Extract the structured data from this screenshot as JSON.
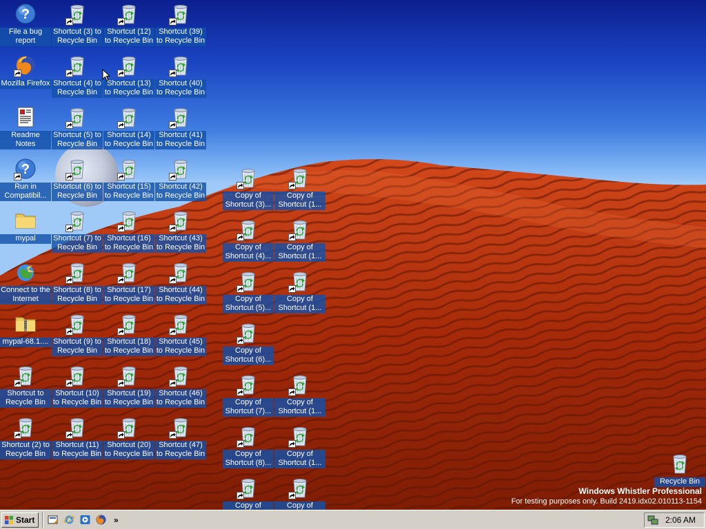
{
  "desktop": {
    "icons": [
      {
        "label": "File a bug report",
        "icon": "help-icon",
        "shortcut": false
      },
      {
        "label": "Mozilla Firefox",
        "icon": "firefox-icon",
        "shortcut": true
      },
      {
        "label": "Readme Notes",
        "icon": "document-icon",
        "shortcut": false
      },
      {
        "label": "Run in Compatibil...",
        "icon": "help-icon",
        "shortcut": true
      },
      {
        "label": "mypal",
        "icon": "folder-icon",
        "shortcut": false
      },
      {
        "label": "Connect to the Internet",
        "icon": "connect-icon",
        "shortcut": false
      },
      {
        "label": "mypal-68.1....",
        "icon": "zip-folder-icon",
        "shortcut": false
      },
      {
        "label": "Shortcut to Recycle Bin",
        "icon": "recycle-bin-icon",
        "shortcut": true
      },
      {
        "label": "Shortcut (2) to Recycle Bin",
        "icon": "recycle-bin-icon",
        "shortcut": true
      },
      {
        "label": "Shortcut (3) to Recycle Bin",
        "icon": "recycle-bin-icon",
        "shortcut": true
      },
      {
        "label": "Shortcut (4) to Recycle Bin",
        "icon": "recycle-bin-icon",
        "shortcut": true
      },
      {
        "label": "Shortcut (5) to Recycle Bin",
        "icon": "recycle-bin-icon",
        "shortcut": true
      },
      {
        "label": "Shortcut (6) to Recycle Bin",
        "icon": "recycle-bin-icon",
        "shortcut": true
      },
      {
        "label": "Shortcut (7) to Recycle Bin",
        "icon": "recycle-bin-icon",
        "shortcut": true
      },
      {
        "label": "Shortcut (8) to Recycle Bin",
        "icon": "recycle-bin-icon",
        "shortcut": true
      },
      {
        "label": "Shortcut (9) to Recycle Bin",
        "icon": "recycle-bin-icon",
        "shortcut": true
      },
      {
        "label": "Shortcut (10) to Recycle Bin",
        "icon": "recycle-bin-icon",
        "shortcut": true
      },
      {
        "label": "Shortcut (11) to Recycle Bin",
        "icon": "recycle-bin-icon",
        "shortcut": true
      },
      {
        "label": "Shortcut (12) to Recycle Bin",
        "icon": "recycle-bin-icon",
        "shortcut": true
      },
      {
        "label": "Shortcut (13) to Recycle Bin",
        "icon": "recycle-bin-icon",
        "shortcut": true
      },
      {
        "label": "Shortcut (14) to Recycle Bin",
        "icon": "recycle-bin-icon",
        "shortcut": true
      },
      {
        "label": "Shortcut (15) to Recycle Bin",
        "icon": "recycle-bin-icon",
        "shortcut": true
      },
      {
        "label": "Shortcut (16) to Recycle Bin",
        "icon": "recycle-bin-icon",
        "shortcut": true
      },
      {
        "label": "Shortcut (17) to Recycle Bin",
        "icon": "recycle-bin-icon",
        "shortcut": true
      },
      {
        "label": "Shortcut (18) to Recycle Bin",
        "icon": "recycle-bin-icon",
        "shortcut": true
      },
      {
        "label": "Shortcut (19) to Recycle Bin",
        "icon": "recycle-bin-icon",
        "shortcut": true
      },
      {
        "label": "Shortcut (20) to Recycle Bin",
        "icon": "recycle-bin-icon",
        "shortcut": true
      },
      {
        "label": "Shortcut (39) to Recycle Bin",
        "icon": "recycle-bin-icon",
        "shortcut": true
      },
      {
        "label": "Shortcut (40) to Recycle Bin",
        "icon": "recycle-bin-icon",
        "shortcut": true
      },
      {
        "label": "Shortcut (41) to Recycle Bin",
        "icon": "recycle-bin-icon",
        "shortcut": true
      },
      {
        "label": "Shortcut (42) to Recycle Bin",
        "icon": "recycle-bin-icon",
        "shortcut": true
      },
      {
        "label": "Shortcut (43) to Recycle Bin",
        "icon": "recycle-bin-icon",
        "shortcut": true
      },
      {
        "label": "Shortcut (44) to Recycle Bin",
        "icon": "recycle-bin-icon",
        "shortcut": true
      },
      {
        "label": "Shortcut (45) to Recycle Bin",
        "icon": "recycle-bin-icon",
        "shortcut": true
      },
      {
        "label": "Shortcut (46) to Recycle Bin",
        "icon": "recycle-bin-icon",
        "shortcut": true
      },
      {
        "label": "Shortcut (47) to Recycle Bin",
        "icon": "recycle-bin-icon",
        "shortcut": true
      },
      {
        "label": "Copy of Shortcut (3)...",
        "icon": "recycle-bin-icon",
        "shortcut": true
      },
      {
        "label": "Copy of Shortcut (4)...",
        "icon": "recycle-bin-icon",
        "shortcut": true
      },
      {
        "label": "Copy of Shortcut (5)...",
        "icon": "recycle-bin-icon",
        "shortcut": true
      },
      {
        "label": "Copy of Shortcut (6)...",
        "icon": "recycle-bin-icon",
        "shortcut": true
      },
      {
        "label": "Copy of Shortcut (7)...",
        "icon": "recycle-bin-icon",
        "shortcut": true
      },
      {
        "label": "Copy of Shortcut (8)...",
        "icon": "recycle-bin-icon",
        "shortcut": true
      },
      {
        "label": "Copy of",
        "icon": "recycle-bin-icon",
        "shortcut": true
      },
      {
        "label": "Copy of Shortcut (1...",
        "icon": "recycle-bin-icon",
        "shortcut": true
      },
      {
        "label": "Copy of Shortcut (1...",
        "icon": "recycle-bin-icon",
        "shortcut": true
      },
      {
        "label": "Copy of Shortcut (1...",
        "icon": "recycle-bin-icon",
        "shortcut": true
      },
      {
        "label": "Copy of Shortcut (1...",
        "icon": "recycle-bin-icon",
        "shortcut": true
      },
      {
        "label": "Copy of Shortcut (1...",
        "icon": "recycle-bin-icon",
        "shortcut": true
      },
      {
        "label": "Copy of",
        "icon": "recycle-bin-icon",
        "shortcut": true
      },
      {
        "label": "Recycle Bin",
        "icon": "recycle-bin-icon",
        "shortcut": false
      }
    ]
  },
  "watermark": {
    "title": "Windows Whistler Professional",
    "build": "For testing purposes only. Build 2419.idx02.010113-1154"
  },
  "taskbar": {
    "start_label": "Start",
    "quick_launch": [
      {
        "name": "show-desktop-icon"
      },
      {
        "name": "internet-explorer-icon"
      },
      {
        "name": "windows-media-player-icon"
      },
      {
        "name": "firefox-icon"
      }
    ],
    "more": "»",
    "clock": "2:06 AM"
  },
  "colors": {
    "sky_top": "#0c1f8e",
    "sand": "#b8330d",
    "label_highlight": "#1450aa",
    "taskbar": "#d4d0c8"
  }
}
